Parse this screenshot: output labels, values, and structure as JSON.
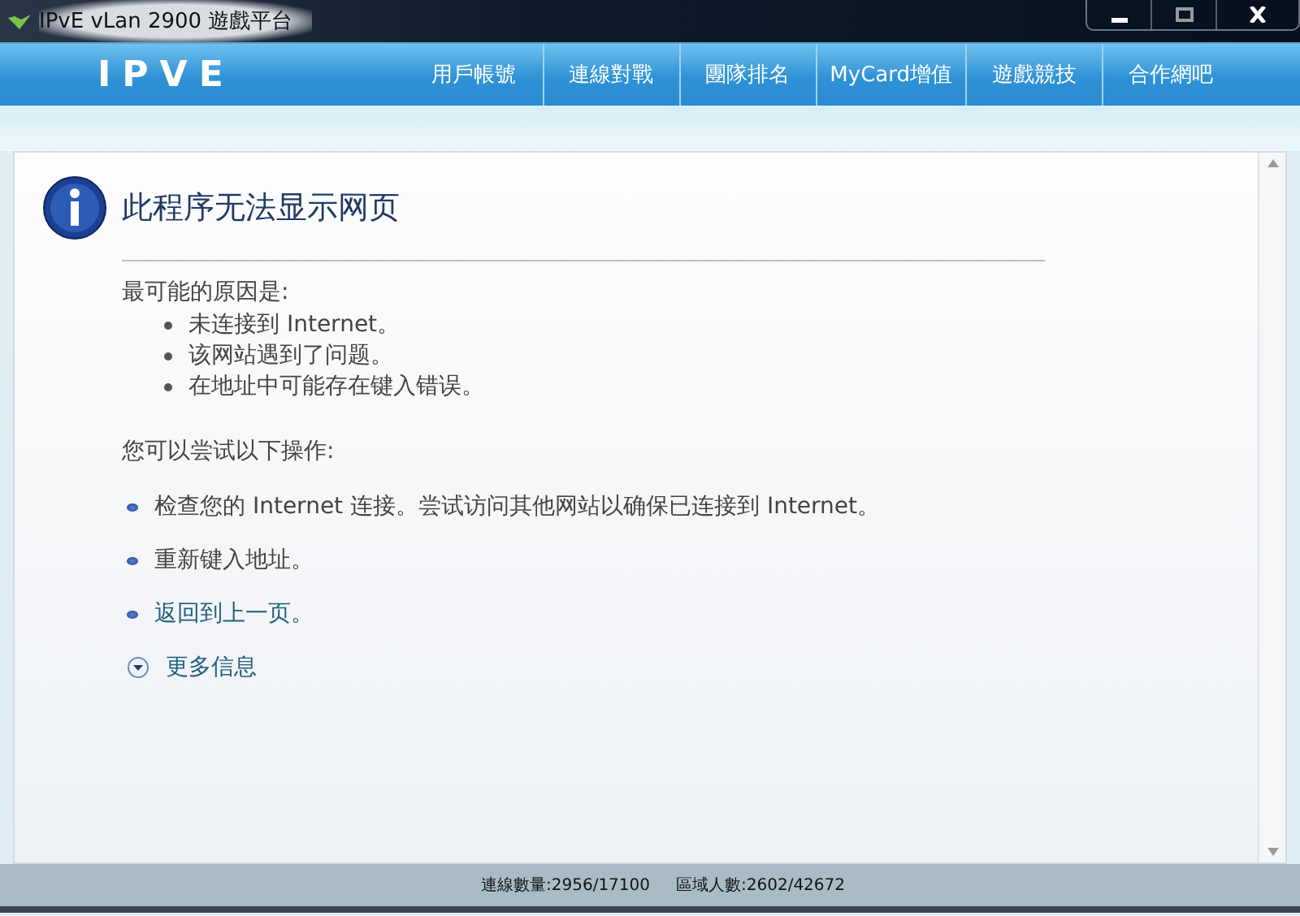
{
  "window": {
    "title": "IPvE vLan 2900 遊戲平台"
  },
  "header": {
    "logo": "IPVE",
    "nav": [
      "用戶帳號",
      "連線對戰",
      "團隊排名",
      "MyCard增值",
      "遊戲競技",
      "合作網吧"
    ]
  },
  "page": {
    "heading": "此程序无法显示网页",
    "causes_intro": "最可能的原因是:",
    "causes": [
      "未连接到 Internet。",
      "该网站遇到了问题。",
      "在地址中可能存在键入错误。"
    ],
    "actions_intro": "您可以尝试以下操作:",
    "actions": [
      {
        "kind": "text",
        "text": "检查您的 Internet 连接。尝试访问其他网站以确保已连接到 Internet。"
      },
      {
        "kind": "text",
        "text": "重新键入地址。"
      },
      {
        "kind": "link",
        "text": "返回到上一页。"
      }
    ],
    "more_info": {
      "label": "更多信息",
      "expanded": false
    }
  },
  "status_bar": [
    "連線數量:2956/17100",
    "區域人數:2602/42672"
  ]
}
